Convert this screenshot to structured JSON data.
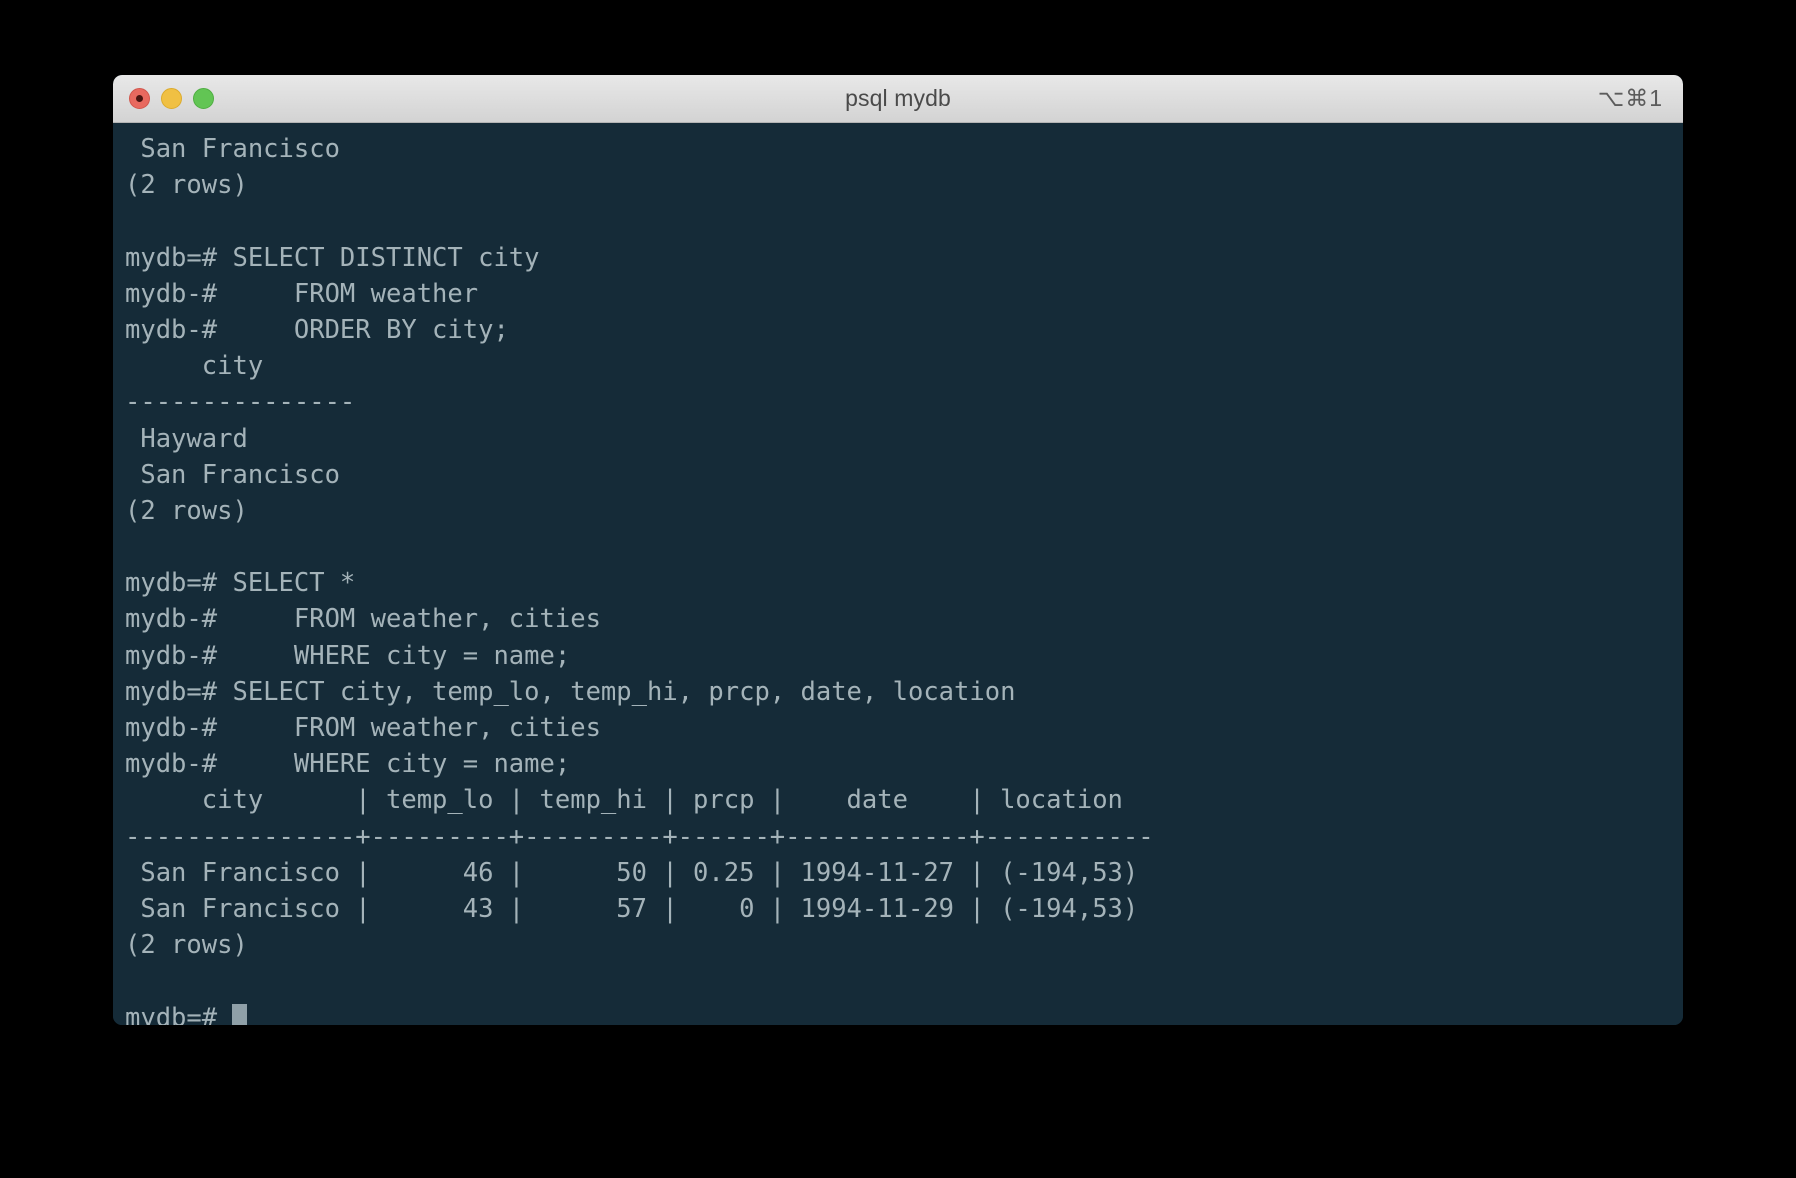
{
  "window": {
    "title": "psql mydb",
    "shortcut": "⌥⌘1",
    "controls": {
      "close_label": "close",
      "minimize_label": "minimize",
      "maximize_label": "maximize"
    }
  },
  "theme": {
    "terminal_background": "#152b38",
    "terminal_foreground": "#a4b3b9",
    "titlebar_background": "#dedede",
    "titlebar_foreground": "#4a4a4a",
    "cursor_color": "#8fa0a8",
    "close_button": "#e8695f",
    "minimize_button": "#f0c043",
    "maximize_button": "#62c554"
  },
  "terminal": {
    "prompt_ready": "mydb=#",
    "prompt_continuation": "mydb-#",
    "lines": [
      " San Francisco",
      "(2 rows)",
      "",
      "mydb=# SELECT DISTINCT city",
      "mydb-#     FROM weather",
      "mydb-#     ORDER BY city;",
      "     city",
      "---------------",
      " Hayward",
      " San Francisco",
      "(2 rows)",
      "",
      "mydb=# SELECT *",
      "mydb-#     FROM weather, cities",
      "mydb-#     WHERE city = name;",
      "mydb=# SELECT city, temp_lo, temp_hi, prcp, date, location",
      "mydb-#     FROM weather, cities",
      "mydb-#     WHERE city = name;",
      "     city      | temp_lo | temp_hi | prcp |    date    | location",
      "---------------+---------+---------+------+------------+-----------",
      " San Francisco |      46 |      50 | 0.25 | 1994-11-27 | (-194,53)",
      " San Francisco |      43 |      57 |    0 | 1994-11-29 | (-194,53)",
      "(2 rows)",
      ""
    ],
    "final_prompt": "mydb=# "
  },
  "result_table": {
    "columns": [
      "city",
      "temp_lo",
      "temp_hi",
      "prcp",
      "date",
      "location"
    ],
    "rows": [
      [
        "San Francisco",
        "46",
        "50",
        "0.25",
        "1994-11-27",
        "(-194,53)"
      ],
      [
        "San Francisco",
        "43",
        "57",
        "0",
        "1994-11-29",
        "(-194,53)"
      ]
    ],
    "row_count_label": "(2 rows)"
  },
  "distinct_city_result": {
    "column": "city",
    "rows": [
      "Hayward",
      "San Francisco"
    ],
    "row_count_label": "(2 rows)"
  }
}
